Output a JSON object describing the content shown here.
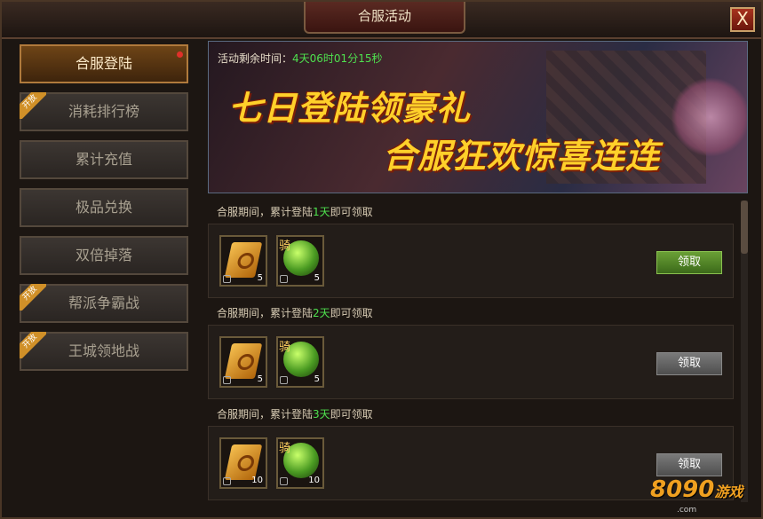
{
  "window": {
    "title": "合服活动",
    "close_label": "X"
  },
  "sidebar": {
    "items": [
      {
        "label": "合服登陆",
        "active": true,
        "badge": "",
        "notify": true
      },
      {
        "label": "消耗排行榜",
        "active": false,
        "badge": "开放",
        "notify": false
      },
      {
        "label": "累计充值",
        "active": false,
        "badge": "",
        "notify": false
      },
      {
        "label": "极品兑换",
        "active": false,
        "badge": "",
        "notify": false
      },
      {
        "label": "双倍掉落",
        "active": false,
        "badge": "",
        "notify": false
      },
      {
        "label": "帮派争霸战",
        "active": false,
        "badge": "开放",
        "notify": false
      },
      {
        "label": "王城领地战",
        "active": false,
        "badge": "开放",
        "notify": false
      }
    ]
  },
  "banner": {
    "timer_label": "活动剩余时间：",
    "timer_value": "4天06时01分15秒",
    "slogan_line1": "七日登陆领豪礼",
    "slogan_line2": "合服狂欢惊喜连连"
  },
  "rewards": [
    {
      "req_prefix": "合服期间，累计登陆",
      "req_days": "1天",
      "req_suffix": "即可领取",
      "items": [
        {
          "icon": "scroll-icon",
          "count": "5",
          "tag": ""
        },
        {
          "icon": "mount-orb-icon",
          "count": "5",
          "tag": "骑"
        }
      ],
      "claim_label": "领取",
      "claimable": true
    },
    {
      "req_prefix": "合服期间，累计登陆",
      "req_days": "2天",
      "req_suffix": "即可领取",
      "items": [
        {
          "icon": "scroll-icon",
          "count": "5",
          "tag": ""
        },
        {
          "icon": "mount-orb-icon",
          "count": "5",
          "tag": "骑"
        }
      ],
      "claim_label": "领取",
      "claimable": false
    },
    {
      "req_prefix": "合服期间，累计登陆",
      "req_days": "3天",
      "req_suffix": "即可领取",
      "items": [
        {
          "icon": "scroll-icon",
          "count": "10",
          "tag": ""
        },
        {
          "icon": "mount-orb-icon",
          "count": "10",
          "tag": "骑"
        }
      ],
      "claim_label": "领取",
      "claimable": false
    }
  ],
  "watermark": {
    "logo_num": "8090",
    "logo_text": "游戏",
    "url": ".com"
  },
  "colors": {
    "highlight_green": "#4ee04e",
    "gold": "#ffd02a",
    "claim_active": "#6aa036"
  }
}
